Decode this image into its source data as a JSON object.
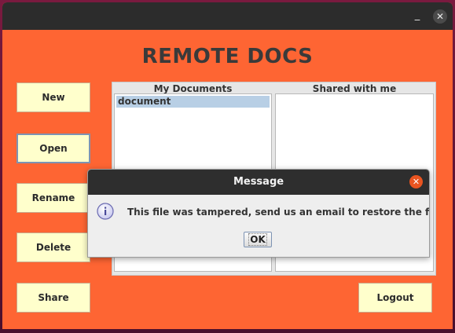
{
  "window": {
    "minimize_glyph": "_",
    "close_glyph": "✕",
    "app_title": "REMOTE DOCS"
  },
  "sidebar": {
    "buttons": [
      {
        "label": "New"
      },
      {
        "label": "Open"
      },
      {
        "label": "Rename"
      },
      {
        "label": "Delete"
      },
      {
        "label": "Share"
      }
    ]
  },
  "lists": {
    "my_documents": {
      "title": "My Documents",
      "items": [
        "document"
      ]
    },
    "shared_with_me": {
      "title": "Shared with me",
      "items": []
    }
  },
  "footer": {
    "logout_label": "Logout"
  },
  "dialog": {
    "title": "Message",
    "close_glyph": "✕",
    "icon": "info-icon",
    "message": "This file was tampered, send us an email to restore the file.",
    "ok_label": "OK"
  },
  "colors": {
    "window_background": "#fe6533",
    "button_background": "#ffffcc",
    "titlebar": "#2c2c2c",
    "dialog_close": "#e95420",
    "selection": "#b8cfe5"
  }
}
